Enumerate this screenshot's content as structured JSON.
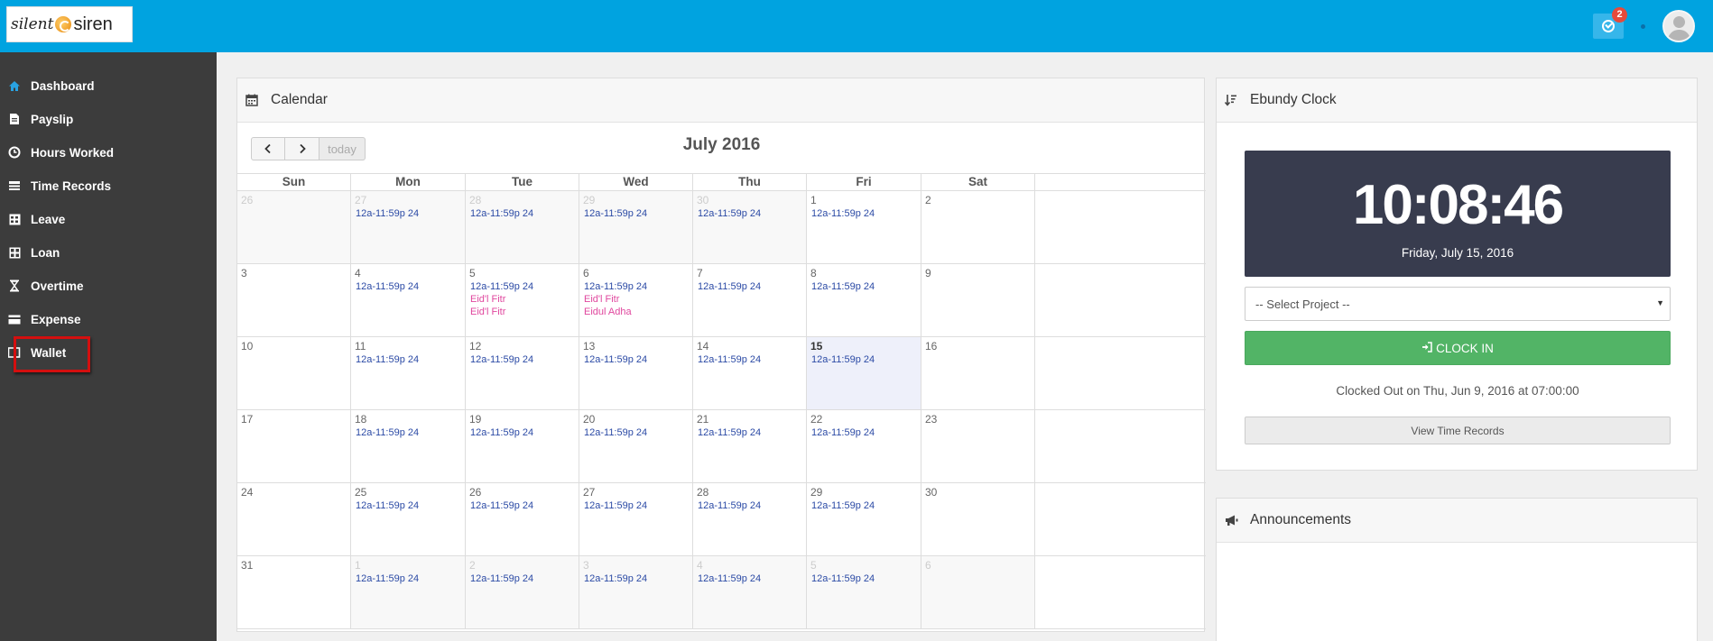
{
  "app": {
    "logo_text_1": "silent",
    "logo_text_2": "siren",
    "task_badge": "2"
  },
  "sidebar": {
    "items": [
      {
        "label": "Dashboard",
        "icon": "home-icon"
      },
      {
        "label": "Payslip",
        "icon": "file-icon"
      },
      {
        "label": "Hours Worked",
        "icon": "clock-icon"
      },
      {
        "label": "Time Records",
        "icon": "records-icon"
      },
      {
        "label": "Leave",
        "icon": "calendar-grid-icon"
      },
      {
        "label": "Loan",
        "icon": "calculator-icon"
      },
      {
        "label": "Overtime",
        "icon": "hourglass-icon"
      },
      {
        "label": "Expense",
        "icon": "card-icon"
      },
      {
        "label": "Wallet",
        "icon": "wallet-icon"
      }
    ],
    "active_color": "#29a3e3",
    "highlight_color": "#d40f0f"
  },
  "calendar": {
    "panel_title": "Calendar",
    "month_title": "July 2016",
    "today_label": "today",
    "prev_label": "<",
    "next_label": ">",
    "days_of_week": [
      "Sun",
      "Mon",
      "Tue",
      "Wed",
      "Thu",
      "Fri",
      "Sat"
    ],
    "weeks": [
      [
        {
          "d": "26",
          "other": true,
          "events": []
        },
        {
          "d": "27",
          "other": true,
          "events": [
            "12a-11:59p 24"
          ]
        },
        {
          "d": "28",
          "other": true,
          "events": [
            "12a-11:59p 24"
          ]
        },
        {
          "d": "29",
          "other": true,
          "events": [
            "12a-11:59p 24"
          ]
        },
        {
          "d": "30",
          "other": true,
          "events": [
            "12a-11:59p 24"
          ]
        },
        {
          "d": "1",
          "events": [
            "12a-11:59p 24"
          ]
        },
        {
          "d": "2",
          "events": []
        }
      ],
      [
        {
          "d": "3",
          "events": []
        },
        {
          "d": "4",
          "events": [
            "12a-11:59p 24"
          ]
        },
        {
          "d": "5",
          "events": [
            "12a-11:59p 24"
          ],
          "holidays": [
            "Eid'l Fitr",
            "Eid'l Fitr"
          ]
        },
        {
          "d": "6",
          "events": [
            "12a-11:59p 24"
          ],
          "holidays": [
            "Eid'l Fitr",
            "Eidul Adha"
          ]
        },
        {
          "d": "7",
          "events": [
            "12a-11:59p 24"
          ]
        },
        {
          "d": "8",
          "events": [
            "12a-11:59p 24"
          ]
        },
        {
          "d": "9",
          "events": []
        }
      ],
      [
        {
          "d": "10",
          "events": []
        },
        {
          "d": "11",
          "events": [
            "12a-11:59p 24"
          ]
        },
        {
          "d": "12",
          "events": [
            "12a-11:59p 24"
          ]
        },
        {
          "d": "13",
          "events": [
            "12a-11:59p 24"
          ]
        },
        {
          "d": "14",
          "events": [
            "12a-11:59p 24"
          ]
        },
        {
          "d": "15",
          "today": true,
          "events": [
            "12a-11:59p 24"
          ]
        },
        {
          "d": "16",
          "events": []
        }
      ],
      [
        {
          "d": "17",
          "events": []
        },
        {
          "d": "18",
          "events": [
            "12a-11:59p 24"
          ]
        },
        {
          "d": "19",
          "events": [
            "12a-11:59p 24"
          ]
        },
        {
          "d": "20",
          "events": [
            "12a-11:59p 24"
          ]
        },
        {
          "d": "21",
          "events": [
            "12a-11:59p 24"
          ]
        },
        {
          "d": "22",
          "events": [
            "12a-11:59p 24"
          ]
        },
        {
          "d": "23",
          "events": []
        }
      ],
      [
        {
          "d": "24",
          "events": []
        },
        {
          "d": "25",
          "events": [
            "12a-11:59p 24"
          ]
        },
        {
          "d": "26",
          "events": [
            "12a-11:59p 24"
          ]
        },
        {
          "d": "27",
          "events": [
            "12a-11:59p 24"
          ]
        },
        {
          "d": "28",
          "events": [
            "12a-11:59p 24"
          ]
        },
        {
          "d": "29",
          "events": [
            "12a-11:59p 24"
          ]
        },
        {
          "d": "30",
          "events": []
        }
      ],
      [
        {
          "d": "31",
          "events": []
        },
        {
          "d": "1",
          "other": true,
          "events": [
            "12a-11:59p 24"
          ]
        },
        {
          "d": "2",
          "other": true,
          "events": [
            "12a-11:59p 24"
          ]
        },
        {
          "d": "3",
          "other": true,
          "events": [
            "12a-11:59p 24"
          ]
        },
        {
          "d": "4",
          "other": true,
          "events": [
            "12a-11:59p 24"
          ]
        },
        {
          "d": "5",
          "other": true,
          "events": [
            "12a-11:59p 24"
          ]
        },
        {
          "d": "6",
          "other": true,
          "events": []
        }
      ]
    ]
  },
  "clock": {
    "panel_title": "Ebundy Clock",
    "time": "10:08:46",
    "date": "Friday, July 15, 2016",
    "project_placeholder": "-- Select Project --",
    "clock_in_label": "CLOCK IN",
    "status_text": "Clocked Out on Thu, Jun 9, 2016 at 07:00:00",
    "view_records_label": "View Time Records"
  },
  "announcements": {
    "panel_title": "Announcements"
  }
}
